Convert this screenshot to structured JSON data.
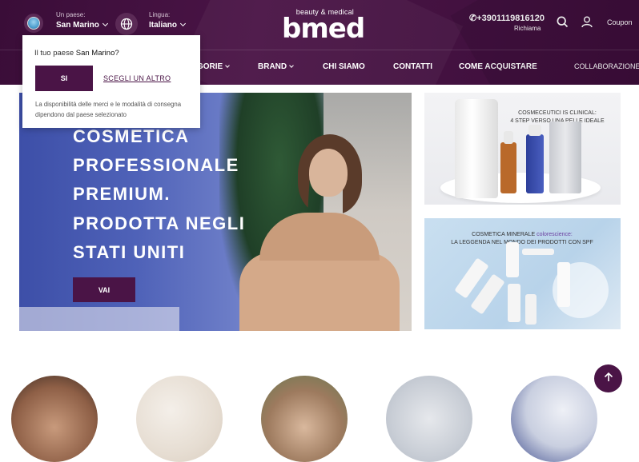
{
  "header": {
    "country_label": "Un paese:",
    "country_value": "San Marino",
    "language_label": "Lingua:",
    "language_value": "Italiano",
    "logo_tagline": "beauty & medical",
    "logo_text": "bmed",
    "phone": "+3901119816120",
    "phone_sub": "Richiama",
    "coupon": "Coupon"
  },
  "nav": {
    "items": [
      {
        "label": "GORIE",
        "dropdown": true
      },
      {
        "label": "BRAND",
        "dropdown": true
      },
      {
        "label": "CHI SIAMO"
      },
      {
        "label": "CONTATTI"
      },
      {
        "label": "COME ACQUISTARE"
      },
      {
        "label": "COLLABORAZIONE"
      }
    ]
  },
  "popup": {
    "question": "Il tuo paese",
    "country": "San Marino?",
    "yes_label": "SI",
    "other_label": "SCEGLI UN ALTRO",
    "note": "La disponibilità delle merci e le modalità di consegna dipendono dal paese selezionato"
  },
  "hero": {
    "lines": [
      "COSMETICA",
      "PROFESSIONALE",
      "PREMIUM.",
      "PRODOTTA NEGLI",
      "STATI UNITI"
    ],
    "button": "VAI"
  },
  "promos": [
    {
      "line1": "COSMECEUTICI IS CLINICAL:",
      "line2": "4 STEP VERSO UNA PELLE IDEALE"
    },
    {
      "line1_prefix": "COSMETICA MINERALE ",
      "line1_accent": "colorescience:",
      "line2": "LA LEGGENDA NEL MONDO DEI PRODOTTI CON SPF"
    }
  ],
  "colors": {
    "brand": "#4a1446",
    "header_bg": "#3a0d38",
    "accent": "#6b3fa0"
  },
  "icons": [
    "country-flag-icon",
    "globe-icon",
    "phone-icon",
    "search-icon",
    "user-icon",
    "arrow-up-icon"
  ]
}
